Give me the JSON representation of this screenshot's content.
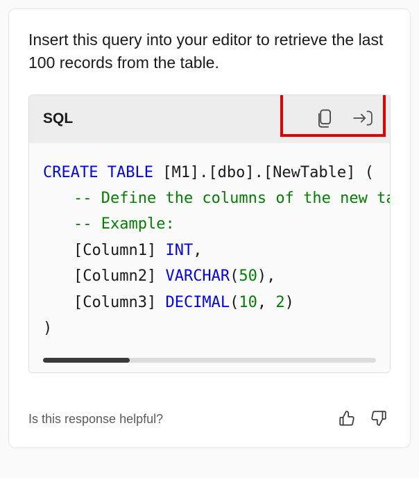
{
  "intro": "Insert this query into your editor to retrieve the last 100 records from the table.",
  "code": {
    "language_label": "SQL",
    "lines": {
      "l1_kw": "CREATE TABLE",
      "l1_rest": " [M1].[dbo].[NewTable] (",
      "l2": "-- Define the columns of the new tabl",
      "l3": "-- Example:",
      "l4_pre": "[Column1] ",
      "l4_kw": "INT",
      "l4_post": ",",
      "l5_pre": "[Column2] ",
      "l5_kw": "VARCHAR",
      "l5_paren1": "(",
      "l5_num": "50",
      "l5_paren2": "),",
      "l6_pre": "[Column3] ",
      "l6_kw": "DECIMAL",
      "l6_paren1": "(",
      "l6_num1": "10",
      "l6_comma": ", ",
      "l6_num2": "2",
      "l6_paren2": ")",
      "l7": ")"
    }
  },
  "feedback": {
    "prompt": "Is this response helpful?"
  },
  "icons": {
    "copy": "copy-icon",
    "insert": "insert-icon",
    "thumbs_up": "thumbs-up-icon",
    "thumbs_down": "thumbs-down-icon"
  }
}
